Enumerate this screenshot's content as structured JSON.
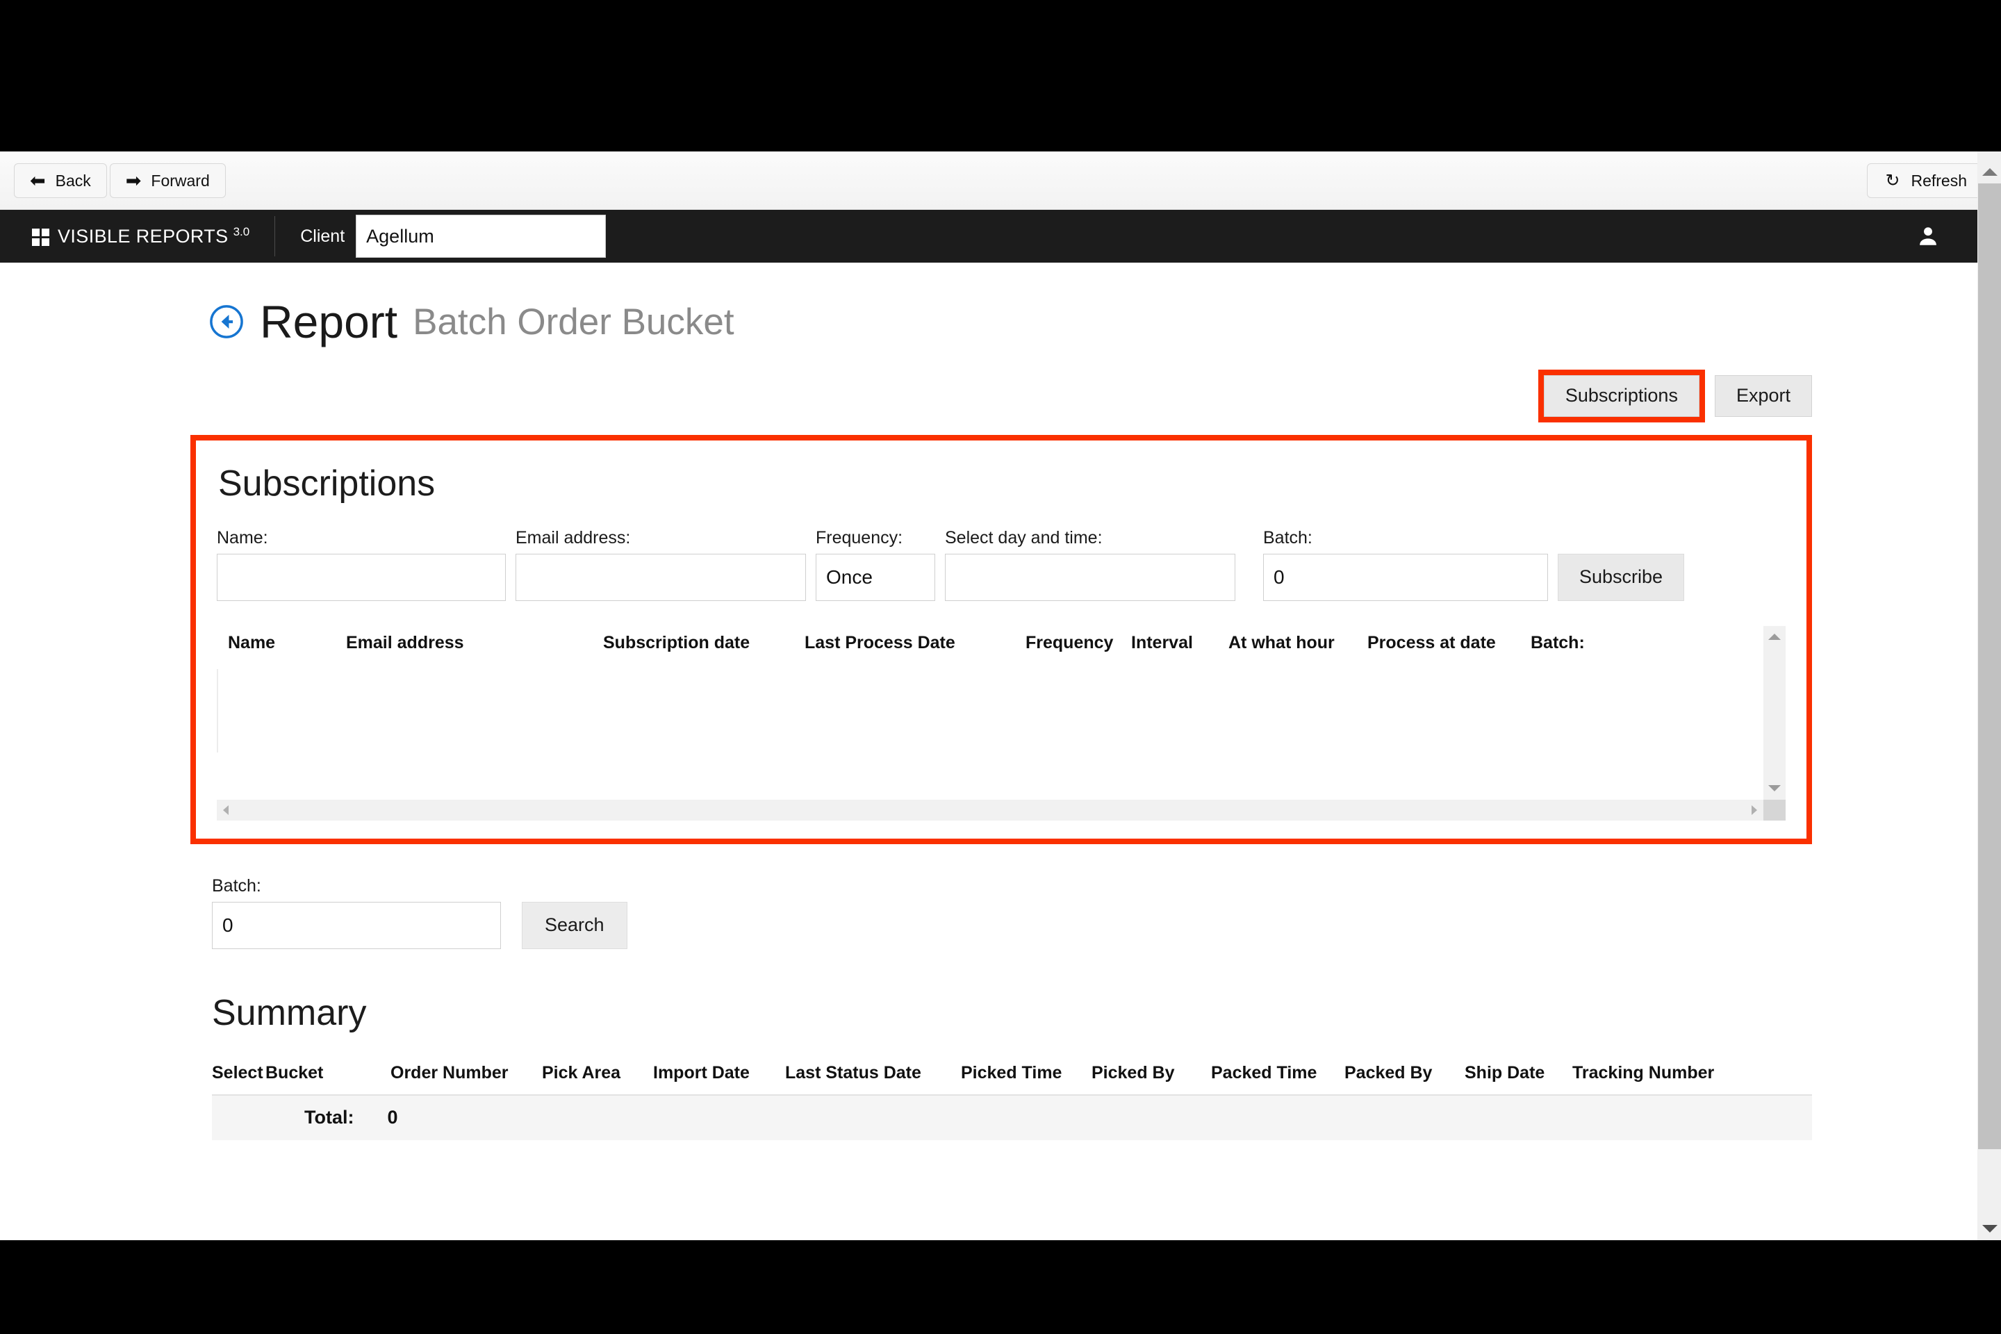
{
  "browser_toolbar": {
    "back_label": "Back",
    "forward_label": "Forward",
    "refresh_label": "Refresh",
    "back_icon": "arrow-left-icon",
    "forward_icon": "arrow-right-icon",
    "refresh_icon": "refresh-icon"
  },
  "appbar": {
    "brand_name": "VISIBLE REPORTS",
    "brand_version": "3.0",
    "client_label": "Client",
    "client_value": "Agellum",
    "user_icon": "user-icon"
  },
  "page": {
    "back_icon": "back-circle-arrow-icon",
    "title": "Report",
    "subtitle": "Batch Order Bucket"
  },
  "actions": {
    "subscriptions_label": "Subscriptions",
    "export_label": "Export",
    "highlight_color": "#fa3000"
  },
  "subscriptions": {
    "heading": "Subscriptions",
    "form": {
      "name_label": "Name:",
      "name_value": "",
      "email_label": "Email address:",
      "email_value": "",
      "frequency_label": "Frequency:",
      "frequency_value": "Once",
      "day_time_label": "Select day and time:",
      "day_time_value": "",
      "batch_label": "Batch:",
      "batch_value": "0",
      "subscribe_label": "Subscribe"
    },
    "columns": [
      "Name",
      "Email address",
      "Subscription date",
      "Last Process Date",
      "Frequency",
      "Interval",
      "At what hour",
      "Process at date",
      "Batch:"
    ],
    "rows": []
  },
  "batch_search": {
    "batch_label": "Batch:",
    "batch_value": "0",
    "search_label": "Search"
  },
  "summary": {
    "heading": "Summary",
    "columns": [
      "Select",
      "Bucket",
      "Order Number",
      "Pick Area",
      "Import Date",
      "Last Status Date",
      "Picked Time",
      "Picked By",
      "Packed Time",
      "Packed By",
      "Ship Date",
      "Tracking Number"
    ],
    "rows": [],
    "total_label": "Total:",
    "total_value": "0"
  }
}
